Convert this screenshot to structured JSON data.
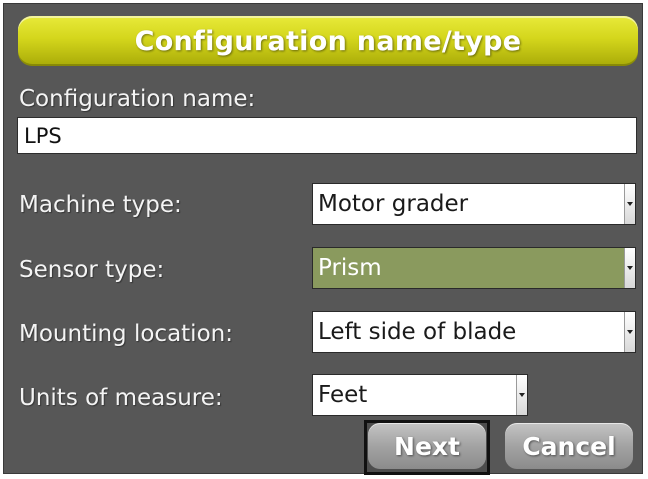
{
  "title": "Configuration name/type",
  "config_name": {
    "label": "Configuration name:",
    "value": "LPS"
  },
  "machine_type": {
    "label": "Machine type:",
    "value": "Motor grader"
  },
  "sensor_type": {
    "label": "Sensor type:",
    "value": "Prism"
  },
  "mounting_location": {
    "label": "Mounting location:",
    "value": "Left side of blade"
  },
  "units": {
    "label": "Units of measure:",
    "value": "Feet"
  },
  "buttons": {
    "next": "Next",
    "cancel": "Cancel"
  },
  "colors": {
    "panel": "#575757",
    "title_bar": "#d4d61c",
    "selected_field": "#8a9a5e"
  },
  "icons": {
    "dropdown": "dropdown-arrow-icon"
  }
}
